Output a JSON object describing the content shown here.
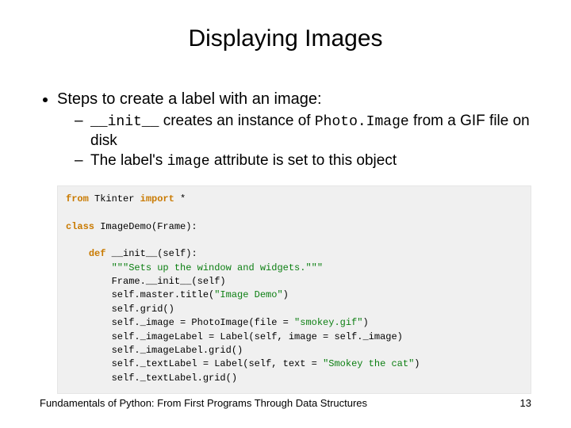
{
  "title": "Displaying Images",
  "bullet1": "Steps to create a label with an image:",
  "sub1_pre": "",
  "sub1_code1": "__init__",
  "sub1_mid": " creates an instance of ",
  "sub1_code2": "Photo.Image",
  "sub1_post": " from a GIF file on disk",
  "sub2_pre": "The label's ",
  "sub2_code": "image",
  "sub2_post": " attribute is set to this object",
  "code": {
    "l01a": "from",
    "l01b": " Tkinter ",
    "l01c": "import",
    "l01d": " *",
    "l02a": "class",
    "l02b": " ImageDemo(Frame):",
    "l03a": "def",
    "l03b": " __init__(self):",
    "l04": "\"\"\"Sets up the window and widgets.\"\"\"",
    "l05": "Frame.__init__(self)",
    "l06a": "self.master.title(",
    "l06b": "\"Image Demo\"",
    "l06c": ")",
    "l07": "self.grid()",
    "l08a": "self._image = PhotoImage(file = ",
    "l08b": "\"smokey.gif\"",
    "l08c": ")",
    "l09": "self._imageLabel = Label(self, image = self._image)",
    "l10": "self._imageLabel.grid()",
    "l11a": "self._textLabel = Label(self, text = ",
    "l11b": "\"Smokey the cat\"",
    "l11c": ")",
    "l12": "self._textLabel.grid()"
  },
  "footer_left": "Fundamentals of Python: From First Programs Through Data Structures",
  "footer_right": "13"
}
